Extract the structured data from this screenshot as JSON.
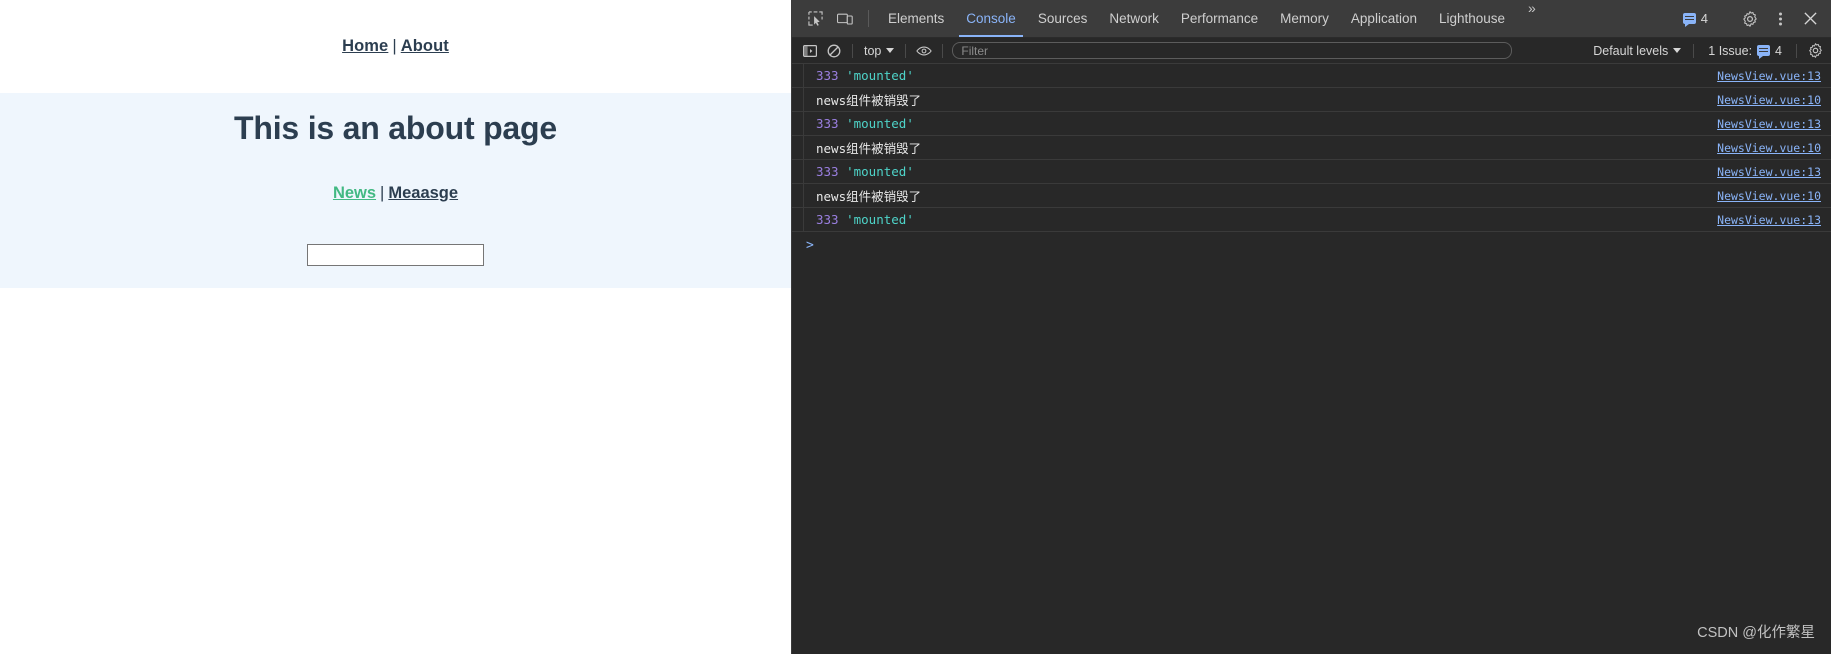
{
  "page": {
    "nav": {
      "home": "Home",
      "about": "About",
      "separator": "|"
    },
    "heading": "This is an about page",
    "subnav": {
      "news": "News",
      "message": "Meaasge",
      "separator": "|"
    },
    "input": {
      "value": "",
      "placeholder": ""
    },
    "colors": {
      "text": "#2c3e50",
      "active_link": "#42b983",
      "section_bg": "#eff6fd"
    }
  },
  "devtools": {
    "tabs": [
      {
        "label": "Elements",
        "active": false
      },
      {
        "label": "Console",
        "active": true
      },
      {
        "label": "Sources",
        "active": false
      },
      {
        "label": "Network",
        "active": false
      },
      {
        "label": "Performance",
        "active": false
      },
      {
        "label": "Memory",
        "active": false
      },
      {
        "label": "Application",
        "active": false
      },
      {
        "label": "Lighthouse",
        "active": false
      }
    ],
    "more_tabs_label": "»",
    "message_count": "4",
    "toolbar": {
      "context": "top",
      "filter_placeholder": "Filter",
      "filter_value": "",
      "levels": "Default levels",
      "issues": "1 Issue:",
      "issues_count": "4"
    },
    "console_rows": [
      {
        "kind": "log",
        "num": "333",
        "str": "'mounted'",
        "source": "NewsView.vue:13"
      },
      {
        "kind": "text",
        "text": "news组件被销毁了",
        "source": "NewsView.vue:10"
      },
      {
        "kind": "log",
        "num": "333",
        "str": "'mounted'",
        "source": "NewsView.vue:13"
      },
      {
        "kind": "text",
        "text": "news组件被销毁了",
        "source": "NewsView.vue:10"
      },
      {
        "kind": "log",
        "num": "333",
        "str": "'mounted'",
        "source": "NewsView.vue:13"
      },
      {
        "kind": "text",
        "text": "news组件被销毁了",
        "source": "NewsView.vue:10"
      },
      {
        "kind": "log",
        "num": "333",
        "str": "'mounted'",
        "source": "NewsView.vue:13"
      }
    ],
    "prompt": ">",
    "accent": "#8ab4f8"
  },
  "watermark": "CSDN @化作繁星"
}
